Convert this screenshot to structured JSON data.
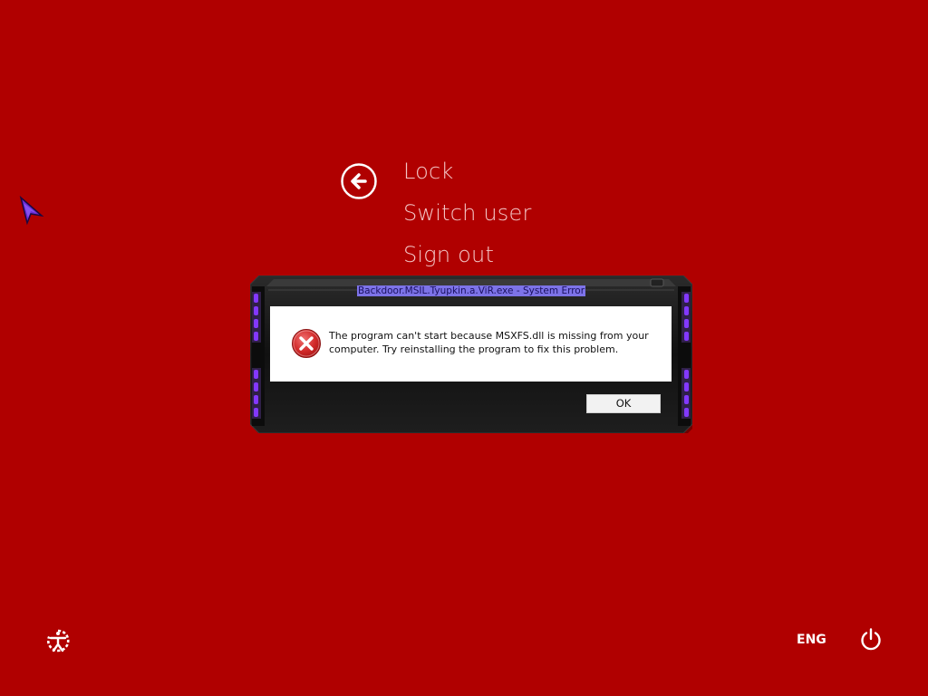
{
  "menu": {
    "back_icon": "back-arrow-icon",
    "items": [
      {
        "label": "Lock"
      },
      {
        "label": "Switch user"
      },
      {
        "label": "Sign out"
      }
    ]
  },
  "dialog": {
    "title": "Backdoor.MSIL.Tyupkin.a.ViR.exe - System Error",
    "icon": "error-icon",
    "message_line1": "The program can't start because MSXFS.dll is missing from your",
    "message_line2": "computer. Try reinstalling the program to fix this problem.",
    "ok_label": "OK"
  },
  "bottom_bar": {
    "ease_of_access_icon": "ease-of-access-icon",
    "language": "ENG",
    "power_icon": "power-icon"
  },
  "colors": {
    "background": "#b00000",
    "menu_text": "#f3c6c6",
    "title_highlight": "#7d73e8",
    "dialog_frame": "#1a1a1a",
    "neon_accent": "#7b2cff"
  }
}
